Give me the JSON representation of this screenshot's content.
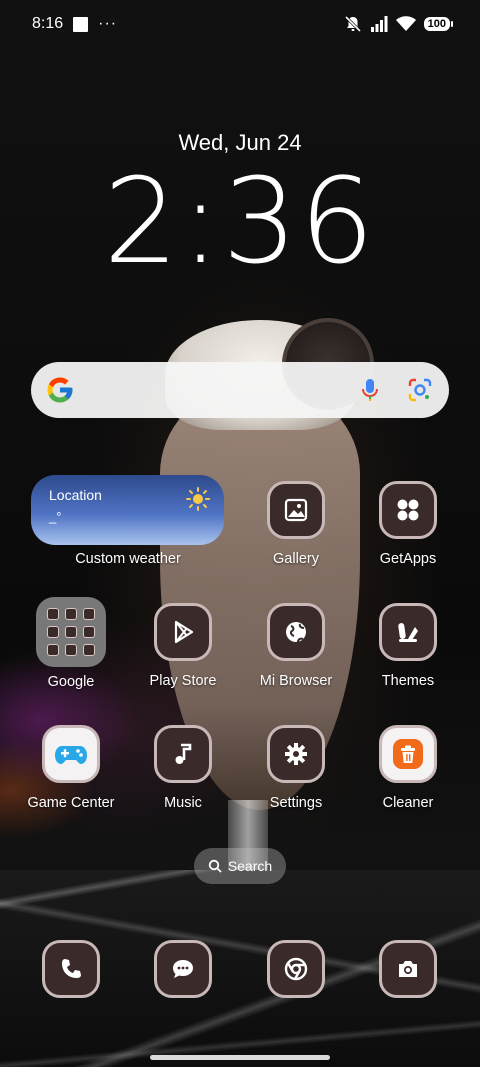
{
  "status": {
    "time": "8:16",
    "more": "···",
    "battery": "100"
  },
  "lockclock": {
    "date": "Wed, Jun 24",
    "time": "2:36"
  },
  "search": {
    "left_icon": "google-g-icon",
    "mic_icon": "microphone-icon",
    "lens_icon": "google-lens-icon"
  },
  "weather": {
    "location": "Location",
    "temp": "_°",
    "label": "Custom weather"
  },
  "apps": {
    "row1": [
      {
        "label": "Gallery",
        "icon": "gallery-icon"
      },
      {
        "label": "GetApps",
        "icon": "getapps-icon"
      }
    ],
    "row2": [
      {
        "label": "Google",
        "icon": "folder-icon"
      },
      {
        "label": "Play Store",
        "icon": "play-store-icon"
      },
      {
        "label": "Mi Browser",
        "icon": "globe-icon"
      },
      {
        "label": "Themes",
        "icon": "themes-icon"
      }
    ],
    "row3": [
      {
        "label": "Game Center",
        "icon": "gamepad-icon"
      },
      {
        "label": "Music",
        "icon": "music-note-icon"
      },
      {
        "label": "Settings",
        "icon": "gear-icon"
      },
      {
        "label": "Cleaner",
        "icon": "trash-icon"
      }
    ]
  },
  "drawer_search": {
    "label": "Search"
  },
  "dock": [
    {
      "icon": "phone-icon"
    },
    {
      "icon": "messages-icon"
    },
    {
      "icon": "chrome-icon"
    },
    {
      "icon": "camera-icon"
    }
  ],
  "colors": {
    "icon_bg": "#3a2a2a",
    "icon_border": "#c9b8b8",
    "weather_top": "#2e4a8c",
    "weather_bottom": "#a9c3ee"
  }
}
